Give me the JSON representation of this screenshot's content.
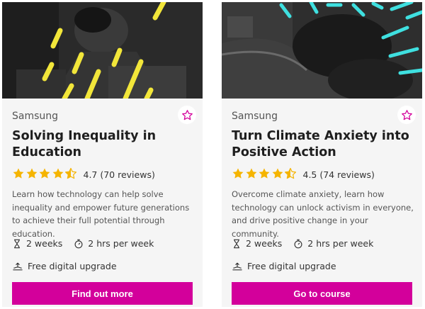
{
  "courses": [
    {
      "provider": "Samsung",
      "title": "Solving Inequality in Education",
      "rating_text": "4.7 (70 reviews)",
      "rating": 4.7,
      "description": "Learn how technology can help solve inequality and empower future generations to achieve their full potential through education.",
      "duration": "2 weeks",
      "effort": "2 hrs per week",
      "upgrade": "Free digital upgrade",
      "cta": "Find out more",
      "image_icon": "education-photo"
    },
    {
      "provider": "Samsung",
      "title": "Turn Climate Anxiety into Positive Action",
      "rating_text": "4.5 (74 reviews)",
      "rating": 4.5,
      "description": "Overcome climate anxiety, learn how technology can unlock activism in everyone, and drive positive change in your community.",
      "duration": "2 weeks",
      "effort": "2 hrs per week",
      "upgrade": "Free digital upgrade",
      "cta": "Go to course",
      "image_icon": "city-aerial-photo"
    }
  ],
  "icons": {
    "favourite": "star-outline-icon",
    "rating": "star-icon",
    "duration": "hourglass-icon",
    "effort": "stopwatch-icon",
    "upgrade": "upgrade-icon"
  },
  "colors": {
    "accent": "#d3009b",
    "star": "#f5b400",
    "card_bg": "#f5f5f5",
    "neon_yellow": "#f2e63a",
    "neon_cyan": "#3fe0e0"
  }
}
